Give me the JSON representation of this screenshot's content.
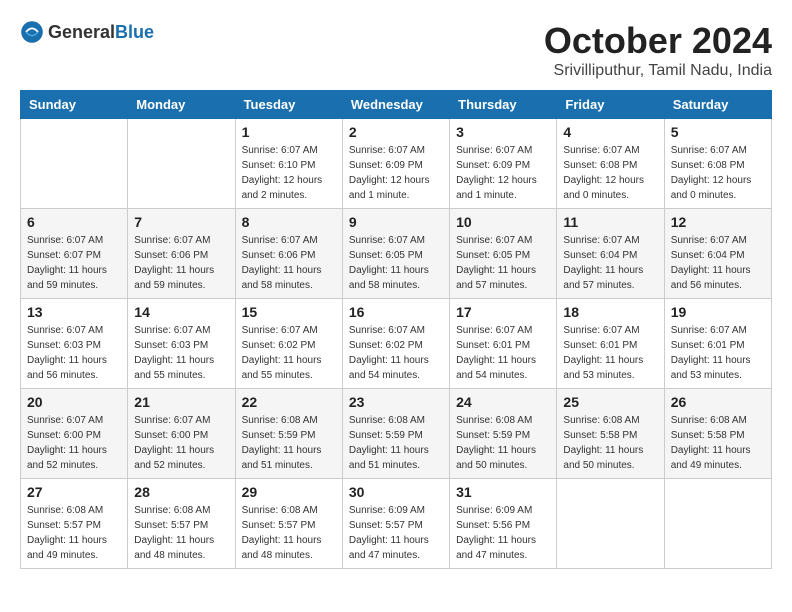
{
  "header": {
    "logo_general": "General",
    "logo_blue": "Blue",
    "month_title": "October 2024",
    "location": "Srivilliputhur, Tamil Nadu, India"
  },
  "weekdays": [
    "Sunday",
    "Monday",
    "Tuesday",
    "Wednesday",
    "Thursday",
    "Friday",
    "Saturday"
  ],
  "weeks": [
    [
      {
        "day": "",
        "sunrise": "",
        "sunset": "",
        "daylight": ""
      },
      {
        "day": "",
        "sunrise": "",
        "sunset": "",
        "daylight": ""
      },
      {
        "day": "1",
        "sunrise": "Sunrise: 6:07 AM",
        "sunset": "Sunset: 6:10 PM",
        "daylight": "Daylight: 12 hours and 2 minutes."
      },
      {
        "day": "2",
        "sunrise": "Sunrise: 6:07 AM",
        "sunset": "Sunset: 6:09 PM",
        "daylight": "Daylight: 12 hours and 1 minute."
      },
      {
        "day": "3",
        "sunrise": "Sunrise: 6:07 AM",
        "sunset": "Sunset: 6:09 PM",
        "daylight": "Daylight: 12 hours and 1 minute."
      },
      {
        "day": "4",
        "sunrise": "Sunrise: 6:07 AM",
        "sunset": "Sunset: 6:08 PM",
        "daylight": "Daylight: 12 hours and 0 minutes."
      },
      {
        "day": "5",
        "sunrise": "Sunrise: 6:07 AM",
        "sunset": "Sunset: 6:08 PM",
        "daylight": "Daylight: 12 hours and 0 minutes."
      }
    ],
    [
      {
        "day": "6",
        "sunrise": "Sunrise: 6:07 AM",
        "sunset": "Sunset: 6:07 PM",
        "daylight": "Daylight: 11 hours and 59 minutes."
      },
      {
        "day": "7",
        "sunrise": "Sunrise: 6:07 AM",
        "sunset": "Sunset: 6:06 PM",
        "daylight": "Daylight: 11 hours and 59 minutes."
      },
      {
        "day": "8",
        "sunrise": "Sunrise: 6:07 AM",
        "sunset": "Sunset: 6:06 PM",
        "daylight": "Daylight: 11 hours and 58 minutes."
      },
      {
        "day": "9",
        "sunrise": "Sunrise: 6:07 AM",
        "sunset": "Sunset: 6:05 PM",
        "daylight": "Daylight: 11 hours and 58 minutes."
      },
      {
        "day": "10",
        "sunrise": "Sunrise: 6:07 AM",
        "sunset": "Sunset: 6:05 PM",
        "daylight": "Daylight: 11 hours and 57 minutes."
      },
      {
        "day": "11",
        "sunrise": "Sunrise: 6:07 AM",
        "sunset": "Sunset: 6:04 PM",
        "daylight": "Daylight: 11 hours and 57 minutes."
      },
      {
        "day": "12",
        "sunrise": "Sunrise: 6:07 AM",
        "sunset": "Sunset: 6:04 PM",
        "daylight": "Daylight: 11 hours and 56 minutes."
      }
    ],
    [
      {
        "day": "13",
        "sunrise": "Sunrise: 6:07 AM",
        "sunset": "Sunset: 6:03 PM",
        "daylight": "Daylight: 11 hours and 56 minutes."
      },
      {
        "day": "14",
        "sunrise": "Sunrise: 6:07 AM",
        "sunset": "Sunset: 6:03 PM",
        "daylight": "Daylight: 11 hours and 55 minutes."
      },
      {
        "day": "15",
        "sunrise": "Sunrise: 6:07 AM",
        "sunset": "Sunset: 6:02 PM",
        "daylight": "Daylight: 11 hours and 55 minutes."
      },
      {
        "day": "16",
        "sunrise": "Sunrise: 6:07 AM",
        "sunset": "Sunset: 6:02 PM",
        "daylight": "Daylight: 11 hours and 54 minutes."
      },
      {
        "day": "17",
        "sunrise": "Sunrise: 6:07 AM",
        "sunset": "Sunset: 6:01 PM",
        "daylight": "Daylight: 11 hours and 54 minutes."
      },
      {
        "day": "18",
        "sunrise": "Sunrise: 6:07 AM",
        "sunset": "Sunset: 6:01 PM",
        "daylight": "Daylight: 11 hours and 53 minutes."
      },
      {
        "day": "19",
        "sunrise": "Sunrise: 6:07 AM",
        "sunset": "Sunset: 6:01 PM",
        "daylight": "Daylight: 11 hours and 53 minutes."
      }
    ],
    [
      {
        "day": "20",
        "sunrise": "Sunrise: 6:07 AM",
        "sunset": "Sunset: 6:00 PM",
        "daylight": "Daylight: 11 hours and 52 minutes."
      },
      {
        "day": "21",
        "sunrise": "Sunrise: 6:07 AM",
        "sunset": "Sunset: 6:00 PM",
        "daylight": "Daylight: 11 hours and 52 minutes."
      },
      {
        "day": "22",
        "sunrise": "Sunrise: 6:08 AM",
        "sunset": "Sunset: 5:59 PM",
        "daylight": "Daylight: 11 hours and 51 minutes."
      },
      {
        "day": "23",
        "sunrise": "Sunrise: 6:08 AM",
        "sunset": "Sunset: 5:59 PM",
        "daylight": "Daylight: 11 hours and 51 minutes."
      },
      {
        "day": "24",
        "sunrise": "Sunrise: 6:08 AM",
        "sunset": "Sunset: 5:59 PM",
        "daylight": "Daylight: 11 hours and 50 minutes."
      },
      {
        "day": "25",
        "sunrise": "Sunrise: 6:08 AM",
        "sunset": "Sunset: 5:58 PM",
        "daylight": "Daylight: 11 hours and 50 minutes."
      },
      {
        "day": "26",
        "sunrise": "Sunrise: 6:08 AM",
        "sunset": "Sunset: 5:58 PM",
        "daylight": "Daylight: 11 hours and 49 minutes."
      }
    ],
    [
      {
        "day": "27",
        "sunrise": "Sunrise: 6:08 AM",
        "sunset": "Sunset: 5:57 PM",
        "daylight": "Daylight: 11 hours and 49 minutes."
      },
      {
        "day": "28",
        "sunrise": "Sunrise: 6:08 AM",
        "sunset": "Sunset: 5:57 PM",
        "daylight": "Daylight: 11 hours and 48 minutes."
      },
      {
        "day": "29",
        "sunrise": "Sunrise: 6:08 AM",
        "sunset": "Sunset: 5:57 PM",
        "daylight": "Daylight: 11 hours and 48 minutes."
      },
      {
        "day": "30",
        "sunrise": "Sunrise: 6:09 AM",
        "sunset": "Sunset: 5:57 PM",
        "daylight": "Daylight: 11 hours and 47 minutes."
      },
      {
        "day": "31",
        "sunrise": "Sunrise: 6:09 AM",
        "sunset": "Sunset: 5:56 PM",
        "daylight": "Daylight: 11 hours and 47 minutes."
      },
      {
        "day": "",
        "sunrise": "",
        "sunset": "",
        "daylight": ""
      },
      {
        "day": "",
        "sunrise": "",
        "sunset": "",
        "daylight": ""
      }
    ]
  ]
}
